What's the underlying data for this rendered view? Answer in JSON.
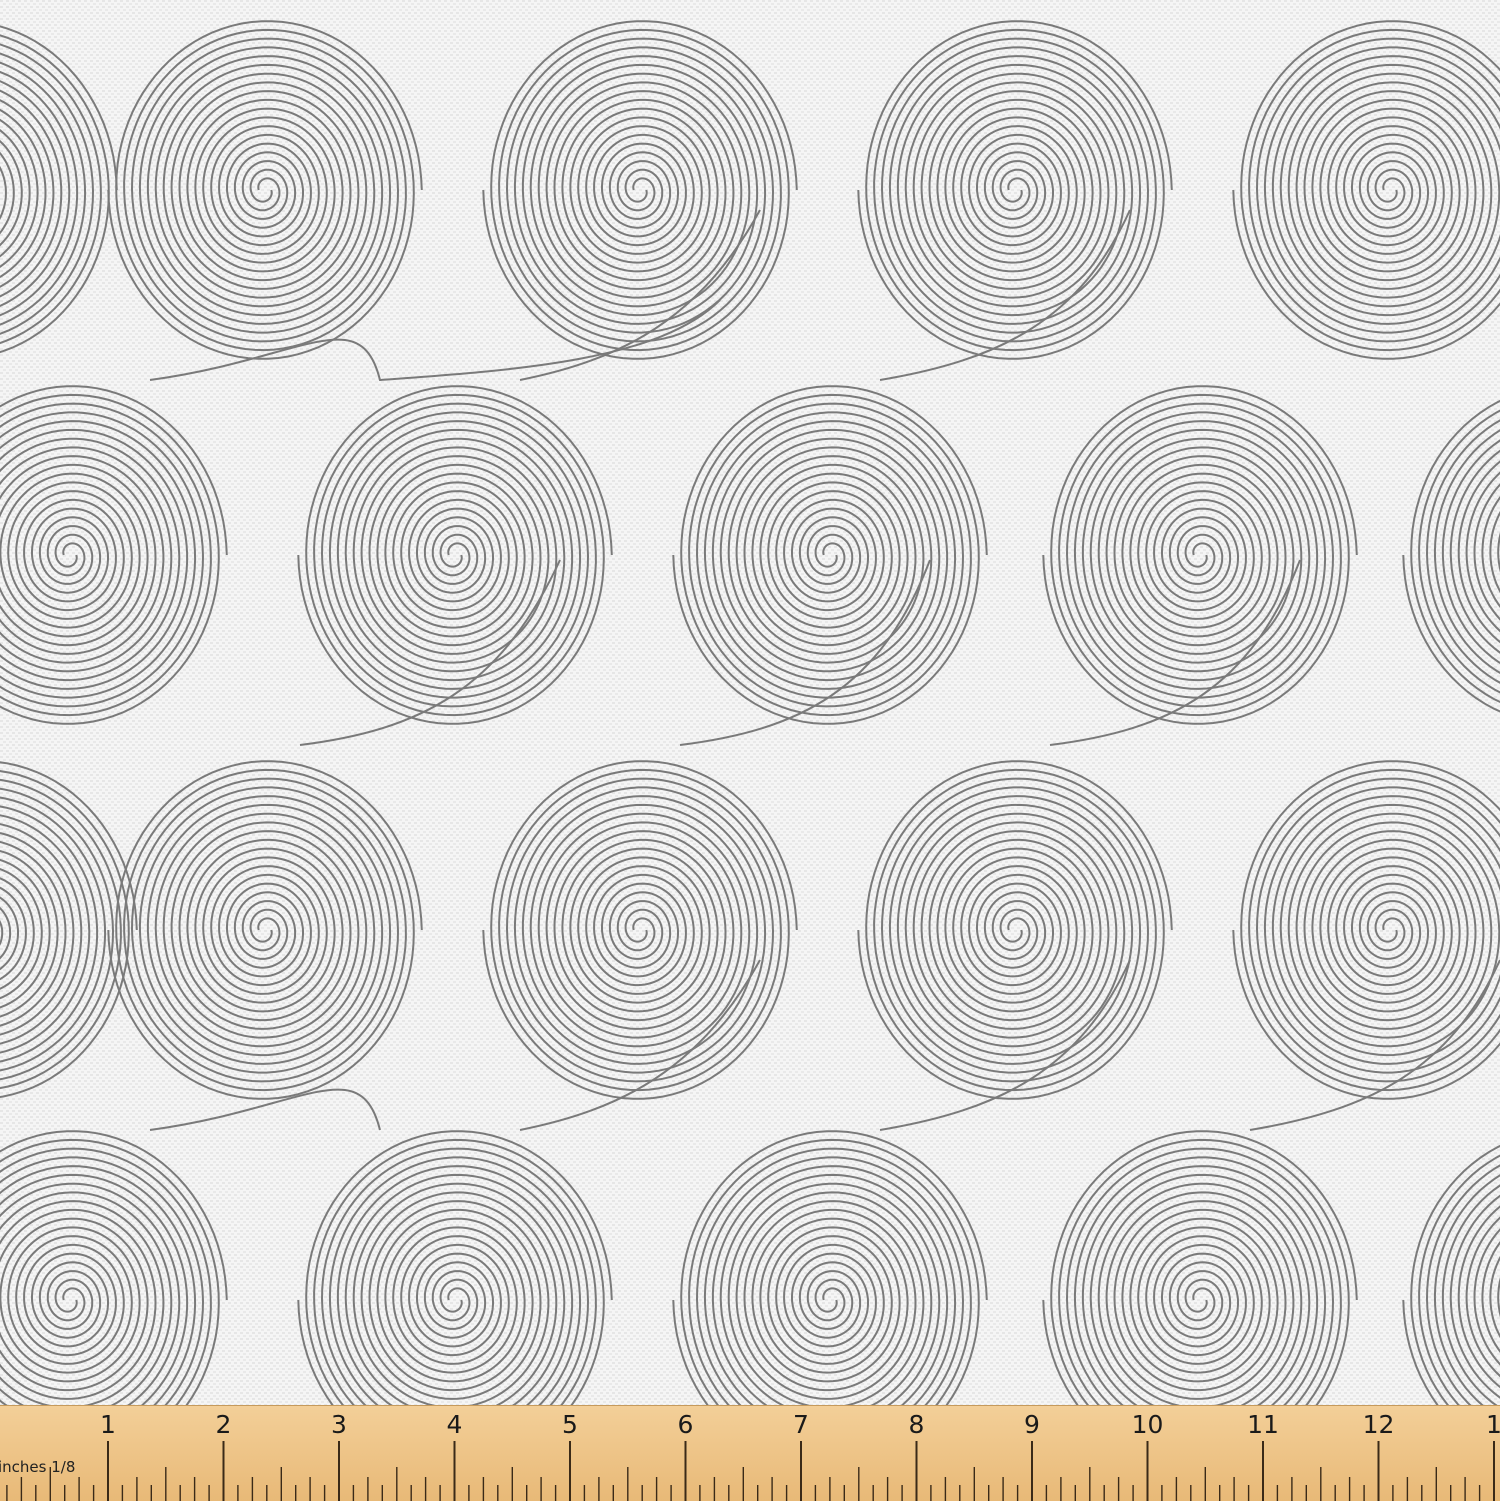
{
  "image": {
    "subject": "fabric swatch with spiral pattern",
    "pattern_color": "#7a7a7a",
    "background_color": "#f4f4f4"
  },
  "ruler": {
    "unit_label": "inches 1/8",
    "numbers": [
      "1",
      "2",
      "3",
      "4",
      "5",
      "6",
      "7",
      "8",
      "9",
      "10",
      "11",
      "12",
      "1"
    ],
    "background_color": "#efc98d"
  }
}
